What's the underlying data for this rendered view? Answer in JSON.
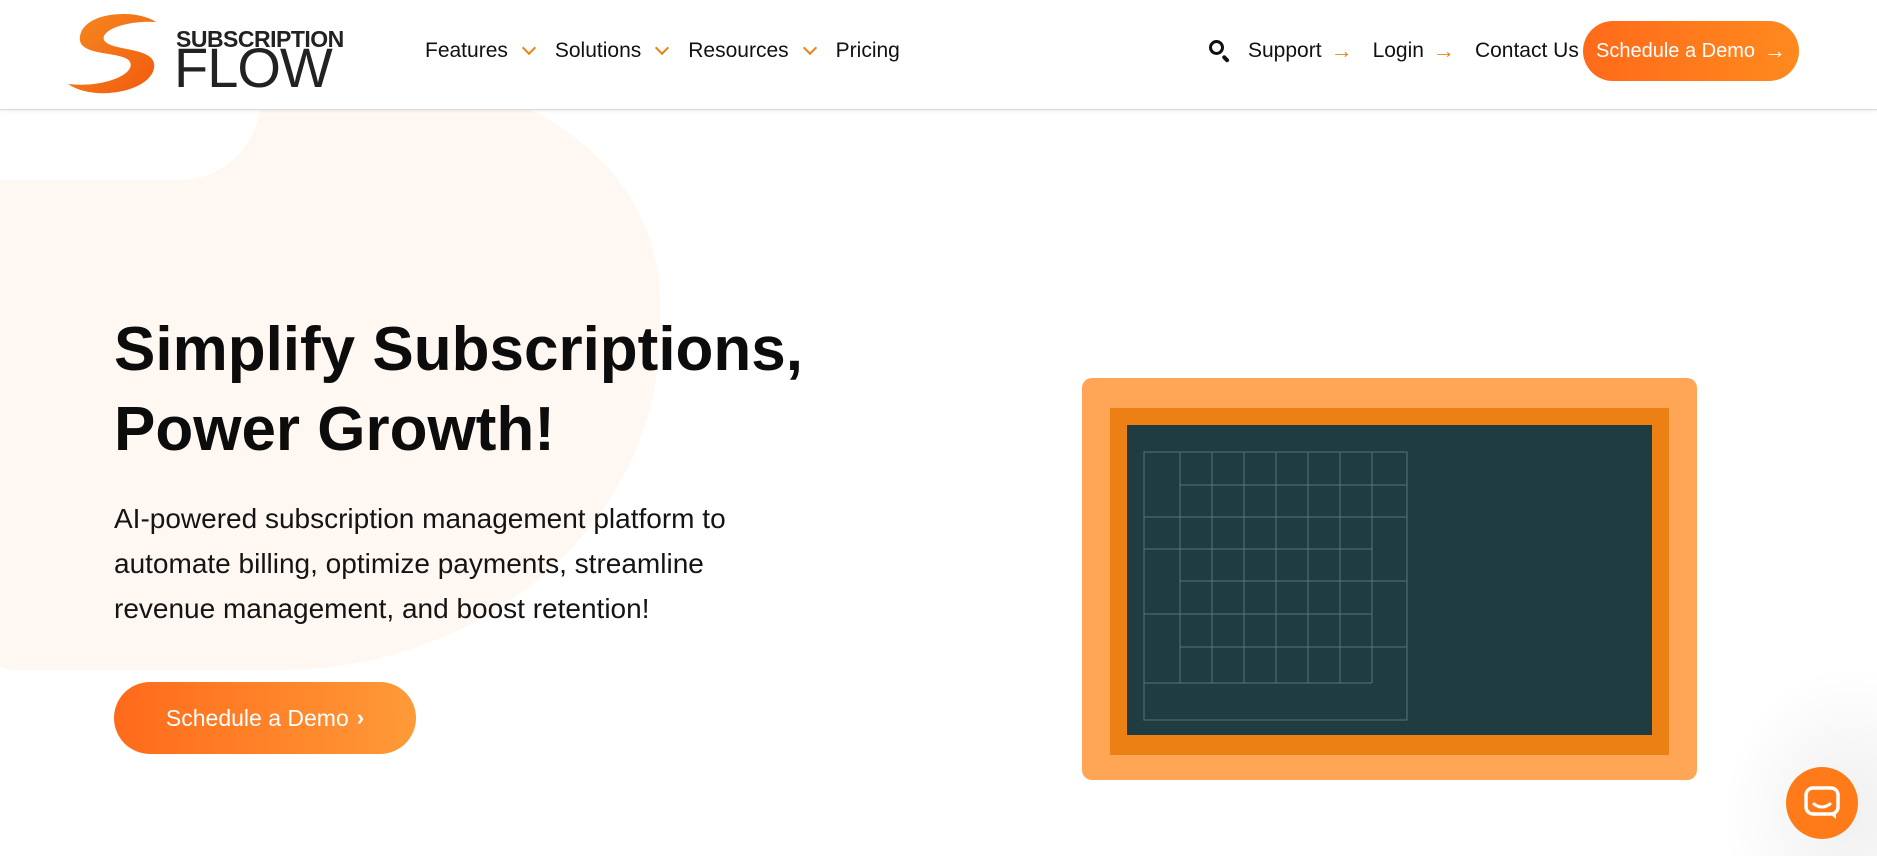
{
  "header": {
    "logo": {
      "top_text": "SUBSCRIPTION",
      "main_text": "FLOW"
    },
    "nav": [
      {
        "label": "Features",
        "has_dropdown": true
      },
      {
        "label": "Solutions",
        "has_dropdown": true
      },
      {
        "label": "Resources",
        "has_dropdown": true
      },
      {
        "label": "Pricing",
        "has_dropdown": false
      }
    ],
    "search_icon": "search-icon",
    "links": {
      "support": "Support",
      "login": "Login",
      "contact": "Contact Us"
    },
    "cta": {
      "label": "Schedule a Demo"
    }
  },
  "hero": {
    "title_line1": "Simplify Subscriptions,",
    "title_line2": "Power Growth!",
    "subtitle_line1": "AI-powered subscription management platform to",
    "subtitle_line2": "automate billing, optimize payments, streamline",
    "subtitle_line3": "revenue management, and boost retention!",
    "cta": {
      "label": "Schedule a Demo"
    }
  },
  "illustration": {
    "icon": "dashboard-grid-illustration"
  },
  "chat_widget": {
    "icon": "chat-bubble-icon"
  },
  "colors": {
    "accent": "#ff7a18",
    "accent_dark": "#ec8014",
    "frame_light": "#ffa556",
    "screen": "#1e3c42"
  }
}
